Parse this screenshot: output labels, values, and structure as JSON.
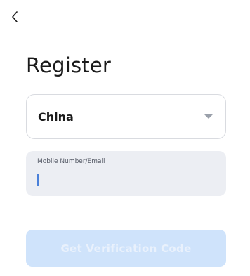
{
  "header": {
    "back_icon": "chevron-left-icon"
  },
  "page": {
    "title": "Register"
  },
  "country_select": {
    "selected": "China",
    "caret_icon": "caret-down-icon"
  },
  "account_field": {
    "label": "Mobile Number/Email",
    "value": ""
  },
  "submit": {
    "label": "Get Verification Code",
    "disabled": true
  },
  "colors": {
    "accent": "#4a80d9",
    "button_disabled_bg": "#cfe3fb",
    "field_bg": "#eceef3"
  }
}
